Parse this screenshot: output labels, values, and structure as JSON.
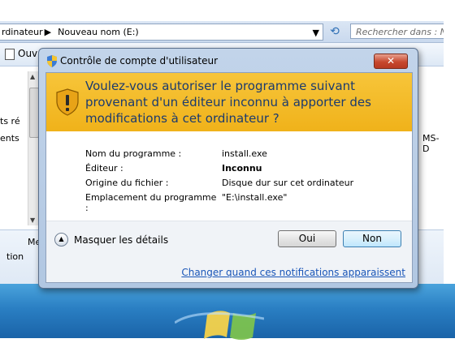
{
  "explorer": {
    "address_path_part1": "rdinateur",
    "address_path_part2": "Nouveau nom (E:)",
    "search_placeholder": "Rechercher dans : N",
    "open_button": "Ouv",
    "left_fragments": [
      "ts ré",
      "ents"
    ],
    "right_fragment": "MS-D",
    "bottom_fragments": [
      "Me",
      "tion"
    ]
  },
  "uac": {
    "title": "Contrôle de compte d'utilisateur",
    "warning": "Voulez-vous autoriser le programme suivant provenant d'un éditeur inconnu à apporter des modifications à cet ordinateur ?",
    "details": [
      {
        "key": "Nom du programme :",
        "value": "install.exe"
      },
      {
        "key": "Éditeur :",
        "value": "Inconnu"
      },
      {
        "key": "Origine du fichier :",
        "value": "Disque dur sur cet ordinateur"
      },
      {
        "key": "Emplacement du programme :",
        "value": "\"E:\\install.exe\""
      }
    ],
    "toggle_label": "Masquer les détails",
    "yes_button": "Oui",
    "no_button": "Non",
    "notification_link": "Changer quand ces notifications apparaissent"
  },
  "colors": {
    "warning_banner": "#f2b823",
    "warning_text": "#1c3b6e",
    "link": "#1a56b8"
  }
}
